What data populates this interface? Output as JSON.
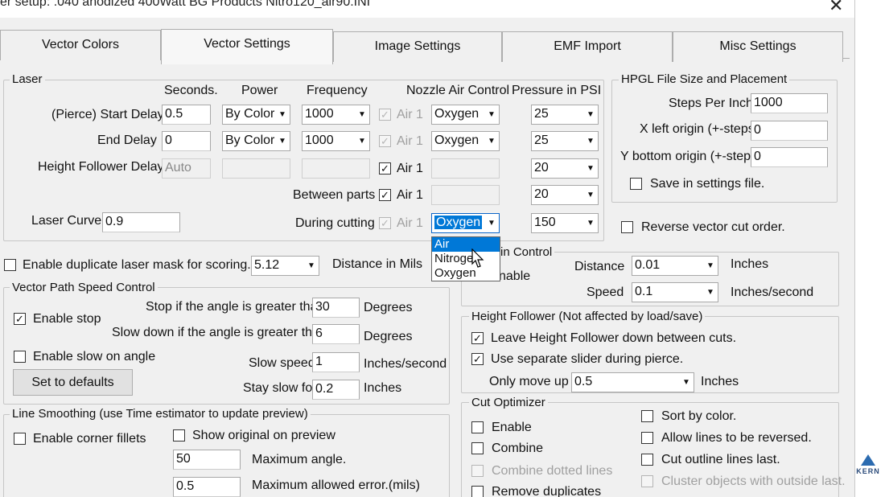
{
  "window": {
    "title": "er setup: .040 anodized 400Watt BG Products Nitro120_air90.INI",
    "close": "✕"
  },
  "tabs": [
    "Vector Colors",
    "Vector Settings",
    "Image Settings",
    "EMF Import",
    "Misc Settings"
  ],
  "laser": {
    "title": "Laser",
    "headers": {
      "seconds": "Seconds.",
      "power": "Power",
      "frequency": "Frequency",
      "nozzle": "Nozzle Air Control",
      "pressure": "Pressure in PSI"
    },
    "rows": {
      "start": {
        "label": "(Pierce) Start Delay",
        "seconds": "0.5",
        "power": "By Color",
        "frequency": "1000",
        "air": "Air 1",
        "gas": "Oxygen",
        "psi": "25"
      },
      "end": {
        "label": "End Delay",
        "seconds": "0",
        "power": "By Color",
        "frequency": "1000",
        "air": "Air 1",
        "gas": "Oxygen",
        "psi": "25"
      },
      "height": {
        "label": "Height Follower Delay",
        "seconds": "Auto",
        "air": "Air 1",
        "psi": "20"
      },
      "between": {
        "label": "Between parts",
        "air": "Air 1",
        "psi": "20"
      },
      "during": {
        "label": "During cutting",
        "air": "Air 1",
        "gas": "Oxygen",
        "psi": "150"
      }
    },
    "curve": {
      "label": "Laser Curve",
      "value": "0.9"
    },
    "gas_options": [
      "Air",
      "Nitroge",
      "Oxygen"
    ]
  },
  "hpgl": {
    "title": "HPGL File Size and Placement",
    "steps": {
      "label": "Steps Per Inch",
      "value": "1000"
    },
    "xorigin": {
      "label": "X left origin (+-steps)",
      "value": "0"
    },
    "yorigin": {
      "label": "Y bottom origin (+-steps)",
      "value": "0"
    },
    "save": "Save in settings file."
  },
  "reverse_vector": "Reverse vector cut order.",
  "dup_mask": {
    "label": "Enable duplicate laser mask for scoring.",
    "value": "5.12",
    "unit": "Distance in Mils"
  },
  "motion": {
    "title_tail": "in Control",
    "enable_tail": "nable",
    "distance": {
      "label": "Distance",
      "value": "0.01",
      "unit": "Inches"
    },
    "speed": {
      "label": "Speed",
      "value": "0.1",
      "unit": "Inches/second"
    }
  },
  "vps": {
    "title": "Vector Path Speed Control",
    "enable_stop": "Enable stop",
    "stop_angle": {
      "label": "Stop if the angle is greater than",
      "value": "30",
      "unit": "Degrees"
    },
    "slow_angle": {
      "label": "Slow down if the angle is greater than",
      "value": "6",
      "unit": "Degrees"
    },
    "enable_slow": "Enable slow on angle",
    "slow_speed": {
      "label": "Slow speed",
      "value": "1",
      "unit": "Inches/second"
    },
    "defaults": "Set to defaults",
    "stay_slow": {
      "label": "Stay slow for",
      "value": "0.2",
      "unit": "Inches"
    }
  },
  "height_follower": {
    "title": "Height Follower (Not affected by load/save)",
    "leave_down": "Leave Height Follower down between cuts.",
    "separate_slider": "Use separate slider during pierce.",
    "only_move": {
      "label": "Only move up",
      "value": "0.5",
      "unit": "Inches"
    }
  },
  "line_smoothing": {
    "title": "Line Smoothing (use Time estimator to update preview)",
    "corner_fillets": "Enable corner fillets",
    "show_original": "Show original on preview",
    "max_angle": {
      "value": "50",
      "label": "Maximum angle."
    },
    "max_error": {
      "value": "0.5",
      "label": "Maximum allowed error.(mils)"
    }
  },
  "cut_optimizer": {
    "title": "Cut Optimizer",
    "enable": "Enable",
    "combine": "Combine",
    "combine_dotted": "Combine dotted lines",
    "remove_dup": "Remove duplicates",
    "sort_color": "Sort by color.",
    "allow_reverse": "Allow lines to be reversed.",
    "outline_last": "Cut outline lines last.",
    "cluster": "Cluster objects with outside last."
  },
  "logo": "KERN",
  "glyphs": {
    "check": "✓",
    "arrow": "▼"
  }
}
